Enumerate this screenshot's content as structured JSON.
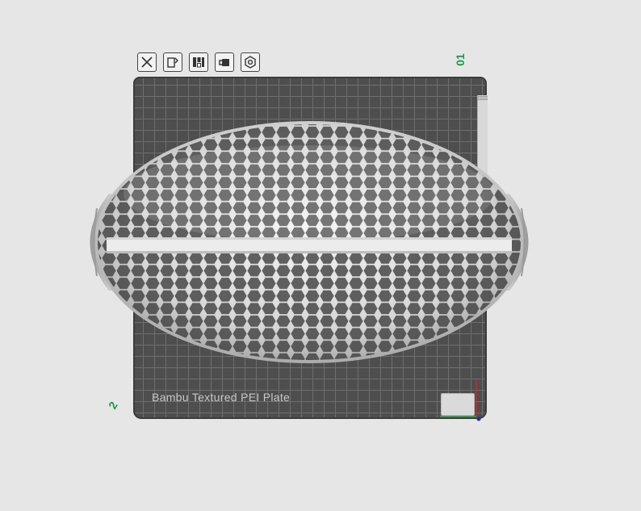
{
  "toolbar": {
    "items": [
      {
        "name": "close-icon"
      },
      {
        "name": "auto-orient-icon"
      },
      {
        "name": "arrange-icon"
      },
      {
        "name": "lock-icon"
      },
      {
        "name": "settings-icon"
      }
    ]
  },
  "plate": {
    "number": "01",
    "label": "Bambu Textured PEI Plate"
  },
  "axes": {
    "x_color": "#2fb34a",
    "y_color": "#d22",
    "z_color": "#2233aa"
  },
  "plate_corner_number": "2",
  "accent_color": "#1a9a4a"
}
